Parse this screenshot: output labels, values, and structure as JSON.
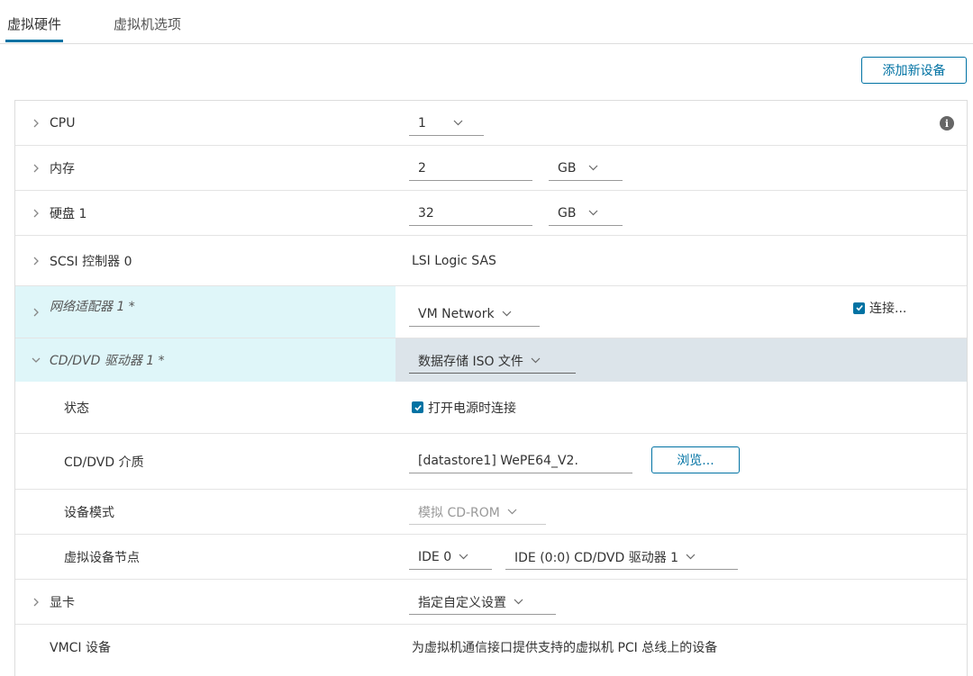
{
  "tabs": [
    {
      "label": "虚拟硬件",
      "active": true
    },
    {
      "label": "虚拟机选项",
      "active": false
    }
  ],
  "add_device_label": "添加新设备",
  "colors": {
    "accent": "#0072a3",
    "highlight": "#dff6f9",
    "selected": "#dce4ea"
  },
  "rows": {
    "cpu": {
      "label": "CPU",
      "value": "1",
      "info_icon": "info-icon"
    },
    "memory": {
      "label": "内存",
      "value": "2",
      "unit": "GB"
    },
    "disk": {
      "label": "硬盘 1",
      "value": "32",
      "unit": "GB"
    },
    "scsi": {
      "label": "SCSI 控制器 0",
      "value": "LSI Logic SAS"
    },
    "network": {
      "label": "网络适配器 1 *",
      "value": "VM Network",
      "connect_label": "连接..."
    },
    "cddvd": {
      "label": "CD/DVD 驱动器 1 *",
      "value": "数据存储 ISO 文件"
    },
    "status": {
      "label": "状态",
      "checkbox_label": "打开电源时连接"
    },
    "media": {
      "label": "CD/DVD 介质",
      "value": "[datastore1] WePE64_V2.",
      "browse_label": "浏览..."
    },
    "device_mode": {
      "label": "设备模式",
      "value": "模拟 CD-ROM"
    },
    "device_node": {
      "label": "虚拟设备节点",
      "controller": "IDE 0",
      "node": "IDE (0:0) CD/DVD 驱动器 1"
    },
    "video": {
      "label": "显卡",
      "value": "指定自定义设置"
    },
    "vmci": {
      "label": "VMCI 设备",
      "value": "为虚拟机通信接口提供支持的虚拟机 PCI 总线上的设备"
    }
  }
}
